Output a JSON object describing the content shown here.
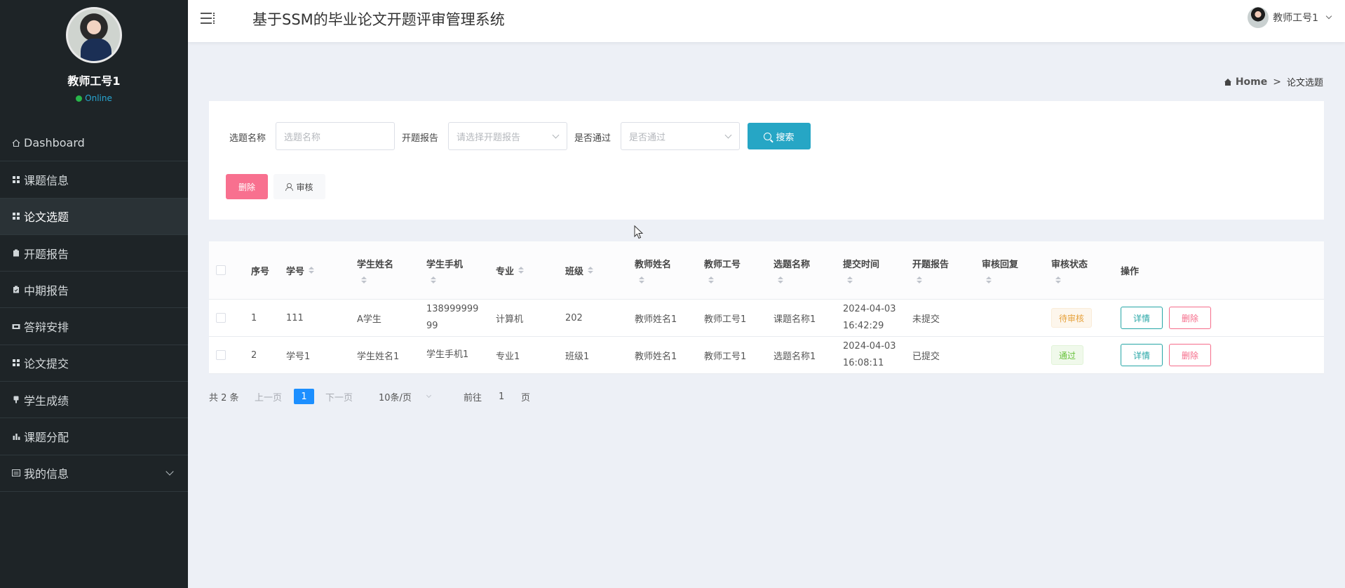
{
  "sidebar": {
    "profile_name": "教师工号1",
    "status": "Online",
    "items": [
      {
        "label": "Dashboard",
        "icon": "home-icon"
      },
      {
        "label": "课题信息",
        "icon": "grid-icon"
      },
      {
        "label": "论文选题",
        "icon": "grid-icon",
        "active": true
      },
      {
        "label": "开题报告",
        "icon": "clipboard-icon"
      },
      {
        "label": "中期报告",
        "icon": "clipboard-check-icon"
      },
      {
        "label": "答辩安排",
        "icon": "ticket-icon"
      },
      {
        "label": "论文提交",
        "icon": "grid-icon"
      },
      {
        "label": "学生成绩",
        "icon": "thumbs-up-icon"
      },
      {
        "label": "课题分配",
        "icon": "bar-chart-icon"
      },
      {
        "label": "我的信息",
        "icon": "id-card-icon"
      }
    ]
  },
  "header": {
    "title": "基于SSM的毕业论文开题评审管理系统",
    "user": "教师工号1"
  },
  "breadcrumb": {
    "home": "Home",
    "separator": ">",
    "current": "论文选题"
  },
  "search": {
    "topic_label": "选题名称",
    "topic_placeholder": "选题名称",
    "report_label": "开题报告",
    "report_placeholder": "请选择开题报告",
    "pass_label": "是否通过",
    "pass_placeholder": "是否通过",
    "search_button": "搜索",
    "delete_button": "删除",
    "audit_button": "审核"
  },
  "table": {
    "headers": {
      "seq": "序号",
      "student_no": "学号",
      "student_name": "学生姓名",
      "student_phone": "学生手机",
      "major": "专业",
      "class": "班级",
      "teacher_name": "教师姓名",
      "teacher_no": "教师工号",
      "topic_name": "选题名称",
      "submit_time": "提交时间",
      "report": "开题报告",
      "audit_reply": "审核回复",
      "audit_status": "审核状态",
      "ops": "操作"
    },
    "rows": [
      {
        "seq": "1",
        "student_no": "111",
        "student_name": "A学生",
        "phone_line1": "138999999",
        "phone_line2": "99",
        "major": "计算机",
        "class": "202",
        "teacher_name": "教师姓名1",
        "teacher_no": "教师工号1",
        "topic_name": "课题名称1",
        "time_date": "2024-04-03",
        "time_clock": "16:42:29",
        "report": "未提交",
        "audit_reply": "",
        "audit_status": "待审核",
        "detail": "详情",
        "delete": "删除"
      },
      {
        "seq": "2",
        "student_no": "学号1",
        "student_name": "学生姓名1",
        "phone_line1": "学生手机1",
        "phone_line2": "",
        "major": "专业1",
        "class": "班级1",
        "teacher_name": "教师姓名1",
        "teacher_no": "教师工号1",
        "topic_name": "选题名称1",
        "time_date": "2024-04-03",
        "time_clock": "16:08:11",
        "report": "已提交",
        "audit_reply": "",
        "audit_status": "通过",
        "detail": "详情",
        "delete": "删除"
      }
    ]
  },
  "pagination": {
    "total": "共 2 条",
    "prev": "上一页",
    "current_page": "1",
    "next": "下一页",
    "page_size": "10条/页",
    "goto_label": "前往",
    "goto_value": "1",
    "page_suffix": "页"
  },
  "colors": {
    "sidebar_bg": "#1e2427",
    "search_button": "#26a6c5",
    "delete_button": "#f8708f",
    "active_page": "#1c8fff",
    "pending_tag": "#e6a23c",
    "passed_tag": "#67c23a"
  }
}
